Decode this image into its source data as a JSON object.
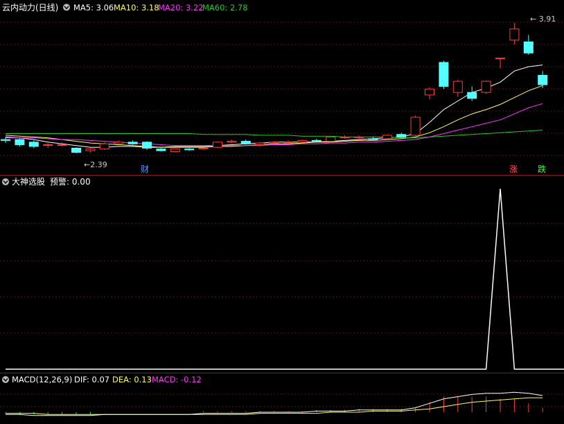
{
  "colors": {
    "background": "#000000",
    "grid": "#5a1818",
    "divider": "#8b1a1a",
    "up_candle": "#ff3b3b",
    "down_candle": "#54ffff",
    "ma5": "#ffffff",
    "ma10": "#ffff55",
    "ma20": "#ff33ff",
    "ma60": "#22cc22",
    "signal_line": "#ffffff",
    "dif": "#ffffff",
    "dea": "#ffff55",
    "macd_bar_pos": "#ff3b3b",
    "macd_bar_neg": "#00ff00",
    "caret": "#aaaaaa"
  },
  "panels": {
    "price": {
      "title": "云内动力(日线)",
      "indicators": [
        {
          "name": "MA5",
          "value": "3.06",
          "color": "#ffffff"
        },
        {
          "name": "MA10",
          "value": "3.18",
          "color": "#ffff55"
        },
        {
          "name": "MA20",
          "value": "3.22",
          "color": "#ff33ff"
        },
        {
          "name": "MA60",
          "value": "2.78",
          "color": "#22cc22"
        }
      ],
      "high_label": "3.91",
      "low_label": "2.39",
      "markers": [
        {
          "text": "财",
          "color": "#5599ff"
        },
        {
          "text": "涨",
          "color": "#ff5555"
        },
        {
          "text": "跌",
          "color": "#44ff44"
        }
      ]
    },
    "signal": {
      "title": "大神选股",
      "label": "预警: 0.00"
    },
    "macd": {
      "title": "MACD(12,26,9)",
      "dif_label": "DIF: 0.07",
      "dea_label": "DEA: 0.13",
      "macd_label": "MACD: -0.12"
    }
  },
  "chart_data": [
    {
      "type": "candlestick",
      "name": "云内动力(日线)",
      "ylim": [
        2.3,
        4.0
      ],
      "high_annotation": 3.91,
      "low_annotation": 2.39,
      "candles": [
        {
          "o": 2.55,
          "h": 2.58,
          "l": 2.51,
          "c": 2.54
        },
        {
          "o": 2.55,
          "h": 2.57,
          "l": 2.47,
          "c": 2.49
        },
        {
          "o": 2.52,
          "h": 2.54,
          "l": 2.45,
          "c": 2.47
        },
        {
          "o": 2.49,
          "h": 2.51,
          "l": 2.45,
          "c": 2.49
        },
        {
          "o": 2.49,
          "h": 2.52,
          "l": 2.47,
          "c": 2.49
        },
        {
          "o": 2.45,
          "h": 2.46,
          "l": 2.39,
          "c": 2.4
        },
        {
          "o": 2.42,
          "h": 2.45,
          "l": 2.4,
          "c": 2.44
        },
        {
          "o": 2.44,
          "h": 2.52,
          "l": 2.43,
          "c": 2.5
        },
        {
          "o": 2.5,
          "h": 2.54,
          "l": 2.48,
          "c": 2.52
        },
        {
          "o": 2.52,
          "h": 2.54,
          "l": 2.49,
          "c": 2.5
        },
        {
          "o": 2.52,
          "h": 2.53,
          "l": 2.43,
          "c": 2.45
        },
        {
          "o": 2.44,
          "h": 2.45,
          "l": 2.41,
          "c": 2.42
        },
        {
          "o": 2.41,
          "h": 2.45,
          "l": 2.4,
          "c": 2.44
        },
        {
          "o": 2.44,
          "h": 2.45,
          "l": 2.42,
          "c": 2.43
        },
        {
          "o": 2.44,
          "h": 2.46,
          "l": 2.43,
          "c": 2.45
        },
        {
          "o": 2.46,
          "h": 2.53,
          "l": 2.45,
          "c": 2.52
        },
        {
          "o": 2.52,
          "h": 2.55,
          "l": 2.51,
          "c": 2.53
        },
        {
          "o": 2.53,
          "h": 2.55,
          "l": 2.49,
          "c": 2.5
        },
        {
          "o": 2.49,
          "h": 2.52,
          "l": 2.47,
          "c": 2.51
        },
        {
          "o": 2.51,
          "h": 2.53,
          "l": 2.49,
          "c": 2.52
        },
        {
          "o": 2.52,
          "h": 2.54,
          "l": 2.5,
          "c": 2.52
        },
        {
          "o": 2.52,
          "h": 2.55,
          "l": 2.51,
          "c": 2.54
        },
        {
          "o": 2.54,
          "h": 2.56,
          "l": 2.52,
          "c": 2.53
        },
        {
          "o": 2.53,
          "h": 2.59,
          "l": 2.52,
          "c": 2.58
        },
        {
          "o": 2.58,
          "h": 2.6,
          "l": 2.56,
          "c": 2.58
        },
        {
          "o": 2.58,
          "h": 2.6,
          "l": 2.56,
          "c": 2.58
        },
        {
          "o": 2.56,
          "h": 2.58,
          "l": 2.54,
          "c": 2.55
        },
        {
          "o": 2.56,
          "h": 2.61,
          "l": 2.55,
          "c": 2.6
        },
        {
          "o": 2.61,
          "h": 2.63,
          "l": 2.57,
          "c": 2.58
        },
        {
          "o": 2.6,
          "h": 2.83,
          "l": 2.59,
          "c": 2.81
        },
        {
          "o": 3.07,
          "h": 3.16,
          "l": 3.02,
          "c": 3.14
        },
        {
          "o": 3.45,
          "h": 3.47,
          "l": 3.14,
          "c": 3.17
        },
        {
          "o": 3.1,
          "h": 3.25,
          "l": 3.05,
          "c": 3.23
        },
        {
          "o": 3.1,
          "h": 3.17,
          "l": 3.0,
          "c": 3.03
        },
        {
          "o": 3.1,
          "h": 3.24,
          "l": 3.08,
          "c": 3.23
        },
        {
          "o": 3.5,
          "h": 3.5,
          "l": 3.38,
          "c": 3.5
        },
        {
          "o": 3.71,
          "h": 3.91,
          "l": 3.66,
          "c": 3.84
        },
        {
          "o": 3.69,
          "h": 3.77,
          "l": 3.54,
          "c": 3.56
        },
        {
          "o": 3.3,
          "h": 3.35,
          "l": 3.15,
          "c": 3.19
        }
      ],
      "series": [
        {
          "name": "MA5",
          "values": [
            2.58,
            2.57,
            2.55,
            2.52,
            2.5,
            2.48,
            2.46,
            2.46,
            2.47,
            2.47,
            2.46,
            2.46,
            2.47,
            2.47,
            2.47,
            2.48,
            2.49,
            2.5,
            2.51,
            2.52,
            2.52,
            2.52,
            2.52,
            2.53,
            2.54,
            2.55,
            2.56,
            2.57,
            2.58,
            2.62,
            2.75,
            2.9,
            3.0,
            3.1,
            3.15,
            3.22,
            3.35,
            3.4,
            3.42
          ]
        },
        {
          "name": "MA10",
          "values": [
            2.6,
            2.59,
            2.58,
            2.57,
            2.55,
            2.53,
            2.51,
            2.5,
            2.49,
            2.48,
            2.47,
            2.46,
            2.46,
            2.46,
            2.46,
            2.47,
            2.47,
            2.48,
            2.49,
            2.5,
            2.5,
            2.51,
            2.52,
            2.52,
            2.53,
            2.54,
            2.54,
            2.55,
            2.56,
            2.58,
            2.63,
            2.7,
            2.78,
            2.85,
            2.9,
            2.96,
            3.04,
            3.12,
            3.18
          ]
        },
        {
          "name": "MA20",
          "values": [
            2.57,
            2.57,
            2.57,
            2.56,
            2.55,
            2.55,
            2.54,
            2.53,
            2.52,
            2.51,
            2.5,
            2.49,
            2.48,
            2.48,
            2.48,
            2.48,
            2.48,
            2.48,
            2.48,
            2.49,
            2.49,
            2.5,
            2.5,
            2.51,
            2.51,
            2.52,
            2.52,
            2.53,
            2.54,
            2.55,
            2.58,
            2.62,
            2.66,
            2.7,
            2.74,
            2.78,
            2.85,
            2.92,
            2.97
          ]
        },
        {
          "name": "MA60",
          "values": [
            2.62,
            2.62,
            2.62,
            2.62,
            2.62,
            2.62,
            2.62,
            2.62,
            2.62,
            2.62,
            2.62,
            2.62,
            2.62,
            2.62,
            2.61,
            2.61,
            2.61,
            2.61,
            2.6,
            2.6,
            2.6,
            2.59,
            2.59,
            2.59,
            2.58,
            2.58,
            2.58,
            2.58,
            2.57,
            2.57,
            2.58,
            2.59,
            2.6,
            2.61,
            2.62,
            2.63,
            2.64,
            2.65,
            2.66
          ]
        }
      ]
    },
    {
      "type": "line",
      "name": "大神选股",
      "ylim": [
        0,
        1
      ],
      "series": [
        {
          "name": "预警",
          "values": [
            0,
            0,
            0,
            0,
            0,
            0,
            0,
            0,
            0,
            0,
            0,
            0,
            0,
            0,
            0,
            0,
            0,
            0,
            0,
            0,
            0,
            0,
            0,
            0,
            0,
            0,
            0,
            0,
            0,
            0,
            0,
            0,
            0,
            0,
            0,
            1,
            0,
            0,
            0
          ]
        }
      ]
    },
    {
      "type": "line",
      "name": "MACD(12,26,9)",
      "ylim": [
        -0.15,
        0.25
      ],
      "series": [
        {
          "name": "DIF",
          "values": [
            -0.02,
            -0.02,
            -0.03,
            -0.03,
            -0.03,
            -0.03,
            -0.03,
            -0.02,
            -0.02,
            -0.02,
            -0.02,
            -0.02,
            -0.02,
            -0.02,
            -0.01,
            -0.01,
            -0.01,
            -0.01,
            0.0,
            0.0,
            0.0,
            0.0,
            0.01,
            0.01,
            0.01,
            0.02,
            0.02,
            0.02,
            0.02,
            0.04,
            0.08,
            0.12,
            0.14,
            0.16,
            0.17,
            0.17,
            0.18,
            0.17,
            0.15
          ]
        },
        {
          "name": "DEA",
          "values": [
            -0.01,
            -0.01,
            -0.01,
            -0.02,
            -0.02,
            -0.02,
            -0.02,
            -0.02,
            -0.02,
            -0.02,
            -0.02,
            -0.02,
            -0.02,
            -0.02,
            -0.02,
            -0.02,
            -0.02,
            -0.02,
            -0.01,
            -0.01,
            -0.01,
            -0.01,
            -0.01,
            0.0,
            0.0,
            0.0,
            0.01,
            0.01,
            0.01,
            0.02,
            0.03,
            0.05,
            0.07,
            0.09,
            0.1,
            0.11,
            0.12,
            0.13,
            0.13
          ]
        },
        {
          "name": "MACD",
          "values": [
            -0.01,
            -0.02,
            -0.02,
            -0.02,
            -0.02,
            -0.02,
            -0.02,
            0.0,
            0.0,
            0.0,
            0.0,
            0.0,
            0.0,
            0.0,
            0.01,
            0.01,
            0.01,
            0.01,
            0.01,
            0.01,
            0.01,
            0.01,
            0.02,
            0.02,
            0.02,
            0.03,
            0.03,
            0.03,
            0.03,
            0.04,
            0.09,
            0.14,
            0.14,
            0.14,
            0.14,
            0.12,
            0.12,
            0.08,
            0.04
          ]
        }
      ]
    }
  ]
}
